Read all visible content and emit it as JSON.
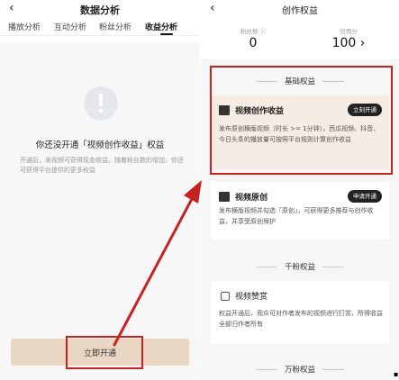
{
  "left": {
    "back_glyph": "‹",
    "title": "数据分析",
    "tabs": [
      {
        "label": "播放分析"
      },
      {
        "label": "互动分析"
      },
      {
        "label": "粉丝分析"
      },
      {
        "label": "收益分析"
      }
    ],
    "heading": "你还没开通「视频创作收益」权益",
    "description": "开通后，发视频可获得现金收益。随着粉丝数的增加，你还可获得平台提供的更多权益",
    "open_button": "立即开通"
  },
  "right": {
    "back_glyph": "‹",
    "title": "创作权益",
    "fans_label": "粉丝数 ⓘ",
    "fans_value": "0",
    "credit_label": "信用分",
    "credit_value": "100 ›",
    "sections": {
      "basic": "基础权益",
      "thousand": "千粉权益",
      "ten_thousand": "万粉权益"
    },
    "cards": {
      "creation_income": {
        "name": "视频创作收益",
        "button": "立刻开通",
        "desc": "发布原创横版视频（时长 >= 1分钟），西瓜视频、抖音、今日头条的播放量可按照平台规则计算创作收益"
      },
      "original": {
        "name": "视频原创",
        "button": "申请开通",
        "desc": "发布横版视频并勾选「原创」，可获得更多推荐与创作收益，并享受原创保护"
      },
      "tip": {
        "name": "视频赞赏",
        "desc": "权益开通后，观众可对作者发布的视频进行打赏，所得收益全部归作者所有"
      }
    }
  },
  "colors": {
    "annotation_red": "#c62222",
    "button_beige": "#e9d7c3",
    "highlight_card": "#f7ece3"
  }
}
